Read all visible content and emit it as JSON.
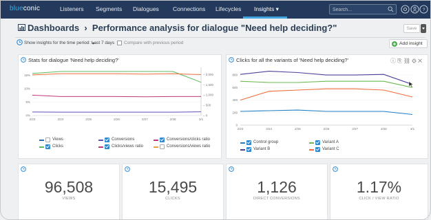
{
  "brand": {
    "part1": "blue",
    "part2": "conic"
  },
  "nav": {
    "items": [
      "Listeners",
      "Segments",
      "Dialogues",
      "Connections",
      "Lifecycles",
      "Insights ▾"
    ],
    "active_index": 5
  },
  "search": {
    "placeholder": "Search..."
  },
  "header_icons": [
    "settings-icon",
    "people-icon",
    "help-icon",
    "logout-icon"
  ],
  "page": {
    "title": "Dashboards  ›  Performance analysis for dialogue \"Need help deciding?\"",
    "save_label": "Save",
    "period_text": "Show insights for the time period:  Last 7 days",
    "period_caret": "▾",
    "compare_label": "Compare with previous period",
    "add_insight_label": "Add insight"
  },
  "colors": {
    "topbar": "#243a5c",
    "accent": "#3fa5e0",
    "page_bg": "#eef0f2",
    "add_green": "#4caf50"
  },
  "charts": {
    "stats": {
      "title": "Stats for dialogue 'Need help deciding?'",
      "legend": [
        {
          "label": "Views",
          "color": "#2a6ab8",
          "checked": false
        },
        {
          "label": "Conversions",
          "color": "#5b4fb8",
          "checked": true
        },
        {
          "label": "Conversions/clicks ratio",
          "color": "#c0357a",
          "checked": true
        },
        {
          "label": "Clicks",
          "color": "#5cb85c",
          "checked": true
        },
        {
          "label": "Clicks/views ratio",
          "color": "#c0357a",
          "checked": true
        },
        {
          "label": "Conversions/views ratio",
          "color": "#f0a030",
          "checked": false
        }
      ]
    },
    "variants": {
      "title": "Clicks for all the variants of 'Need help deciding?'",
      "legend": [
        {
          "label": "Control group",
          "color": "#1f7fc4",
          "checked": true
        },
        {
          "label": "Variant A",
          "color": "#6cb84f",
          "checked": true
        },
        {
          "label": "Variant B",
          "color": "#4b3f9a",
          "checked": true
        },
        {
          "label": "Variant C",
          "color": "#ef6c3a",
          "checked": true
        }
      ]
    }
  },
  "chart_data": [
    {
      "type": "line",
      "title": "Stats for dialogue 'Need help deciding?'",
      "x": [
        "2/23",
        "2/24",
        "2/25",
        "2/26",
        "2/27",
        "2/28",
        "3/1"
      ],
      "y_left_ticks": [
        "0%",
        "5%",
        "10%",
        "15%"
      ],
      "y_right_ticks": [
        "0",
        "500",
        "1,000",
        "1,500",
        "2,000"
      ],
      "ylim_left": [
        0,
        18
      ],
      "ylim_right": [
        0,
        2350
      ],
      "series": [
        {
          "name": "Clicks",
          "axis": "right",
          "color": "#5cb85c",
          "values": [
            2050,
            2150,
            2150,
            2150,
            2150,
            2150,
            1620
          ]
        },
        {
          "name": "Clicks/views ratio",
          "axis": "left",
          "color": "#ef6c3a",
          "values": [
            15.2,
            15.6,
            15.6,
            15.6,
            15.5,
            15.6,
            15.3
          ]
        },
        {
          "name": "Conversions/clicks ratio",
          "axis": "left",
          "color": "#c0357a",
          "values": [
            7.6,
            7.1,
            7.1,
            7.1,
            7.0,
            7.1,
            7.1
          ]
        },
        {
          "name": "Conversions",
          "axis": "right",
          "color": "#5b4fb8",
          "values": [
            170,
            165,
            165,
            165,
            165,
            165,
            180
          ]
        }
      ]
    },
    {
      "type": "line",
      "title": "Clicks for all the variants of 'Need help deciding?'",
      "x": [
        "2/23",
        "2/24",
        "2/25",
        "2/26",
        "2/27",
        "2/28",
        "3/1"
      ],
      "y_ticks": [
        "0",
        "200",
        "400",
        "600",
        "800"
      ],
      "ylim": [
        0,
        900
      ],
      "series": [
        {
          "name": "Variant B",
          "color": "#4b3f9a",
          "values": [
            810,
            860,
            840,
            800,
            800,
            810,
            650
          ]
        },
        {
          "name": "Variant A",
          "color": "#6cb84f",
          "values": [
            700,
            680,
            680,
            700,
            700,
            700,
            600
          ]
        },
        {
          "name": "Variant C",
          "color": "#ef6c3a",
          "values": [
            400,
            540,
            560,
            580,
            580,
            560,
            450
          ]
        },
        {
          "name": "Control group",
          "color": "#1f7fc4",
          "values": [
            220,
            230,
            240,
            220,
            220,
            220,
            170
          ]
        }
      ]
    }
  ],
  "kpis": [
    {
      "value": "96,508",
      "label": "VIEWS"
    },
    {
      "value": "15,495",
      "label": "CLICKS"
    },
    {
      "value": "1,126",
      "label": "DIRECT CONVERSIONS"
    },
    {
      "value": "1.17%",
      "label": "CLICK / VIEW RATIO"
    }
  ]
}
